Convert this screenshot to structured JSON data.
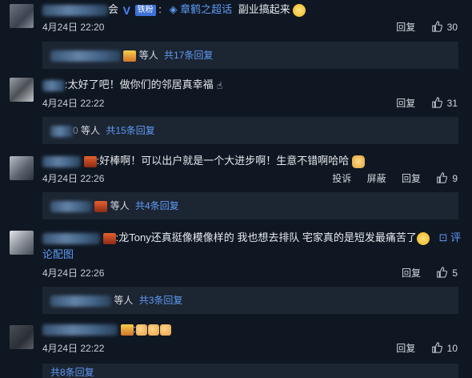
{
  "comments": [
    {
      "username_suffix": "会",
      "verified_mark": "V",
      "fan_badge": "铁粉",
      "separator": ":",
      "topic_icon": "◈",
      "topic": "章鹤之超话",
      "text": "副业搞起来",
      "date": "4月24日 22:20",
      "reply_label": "回复",
      "likes": "30",
      "thread": {
        "people": "等人",
        "count_label": "共17条回复"
      }
    },
    {
      "separator": ":",
      "text": "太好了吧！做你们的邻居真幸福",
      "date": "4月24日 22:22",
      "reply_label": "回复",
      "likes": "31",
      "thread": {
        "people_prefix": "0",
        "people": "等人",
        "count_label": "共15条回复"
      }
    },
    {
      "separator": ":",
      "text": "好棒啊！可以出户就是一个大进步啊！生意不错啊哈哈",
      "date": "4月24日 22:26",
      "report_label": "投诉",
      "block_label": "屏蔽",
      "reply_label": "回复",
      "likes": "9",
      "thread": {
        "people": "等人",
        "count_label": "共4条回复"
      }
    },
    {
      "separator": ":",
      "text": "龙Tony还真挺像模像样的 我也想去排队 宅家真的是短发最痛苦了",
      "image_link": "评论配图",
      "date": "4月24日 22:26",
      "reply_label": "回复",
      "likes": "5",
      "thread": {
        "people": "等人",
        "count_label": "共3条回复"
      }
    },
    {
      "separator": ":",
      "date": "4月24日 22:22",
      "reply_label": "回复",
      "likes": "10",
      "thread": {
        "count_label": "共8条回复"
      }
    }
  ],
  "icons": {
    "like": "thumbs-up-outline",
    "topic": "super-topic-icon"
  },
  "colors": {
    "background": "#0f1722",
    "reply_box": "#1c2532",
    "link": "#5e9bf5",
    "verified": "#4d86ff",
    "fan_badge": "#3f72d8"
  }
}
